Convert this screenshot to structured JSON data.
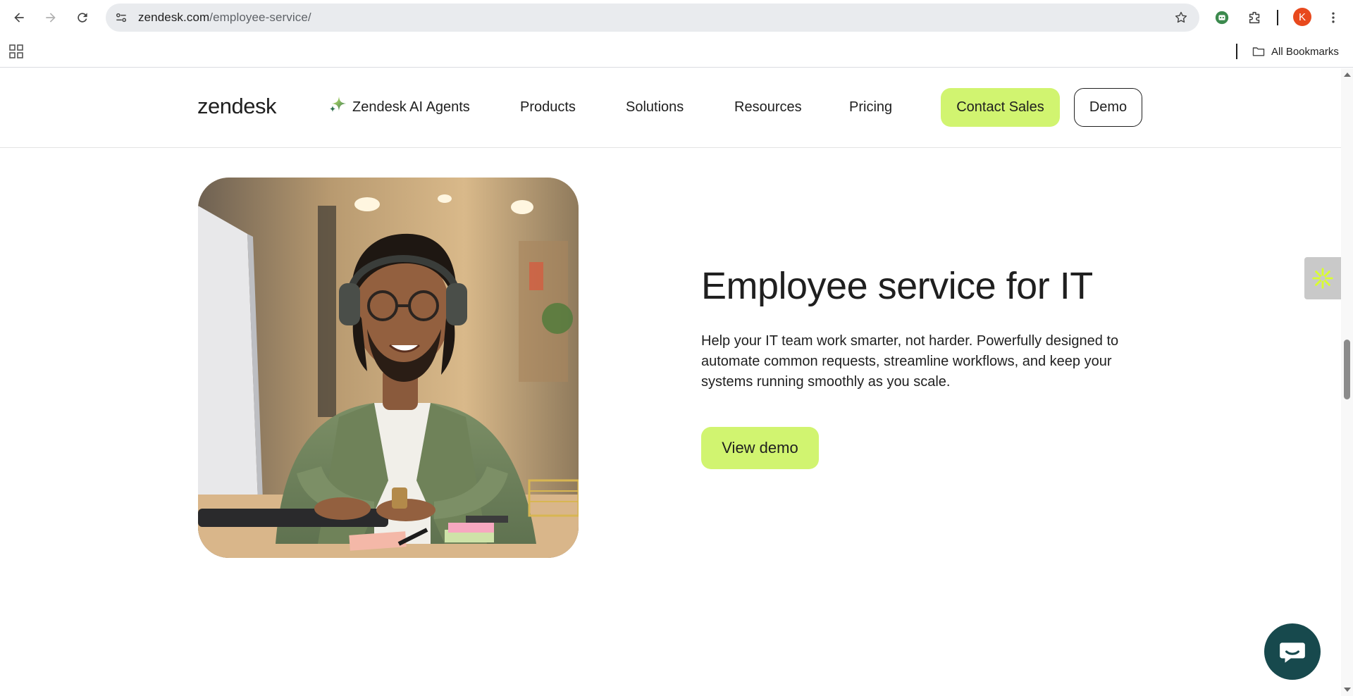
{
  "browser": {
    "url_host": "zendesk.com",
    "url_path": "/employee-service/",
    "profile_initial": "K",
    "bookmarks_label": "All Bookmarks"
  },
  "header": {
    "logo": "zendesk",
    "nav": {
      "ai_agents": "Zendesk AI Agents",
      "products": "Products",
      "solutions": "Solutions",
      "resources": "Resources",
      "pricing": "Pricing"
    },
    "contact_sales": "Contact Sales",
    "demo": "Demo"
  },
  "hero": {
    "title": "Employee service for IT",
    "body": "Help your IT team work smarter, not harder.  Powerfully designed to automate common requests, streamline workflows, and keep your systems running smoothly as you scale.",
    "cta": "View demo"
  },
  "colors": {
    "accent": "#d1f470",
    "chat_button": "#17494d",
    "profile": "#e8491d"
  }
}
